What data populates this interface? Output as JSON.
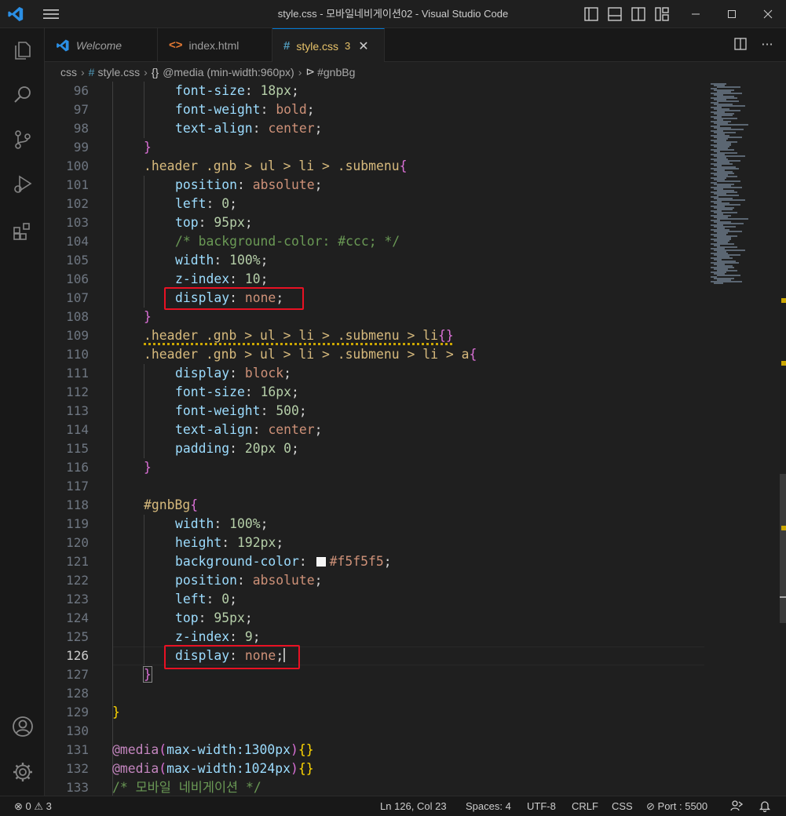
{
  "window": {
    "title": "style.css - 모바일네비게이션02 - Visual Studio Code"
  },
  "tabs": [
    {
      "label": "Welcome",
      "icon": "vscode-icon"
    },
    {
      "label": "index.html",
      "icon": "html-icon"
    },
    {
      "label": "style.css",
      "icon": "css-icon",
      "badge": "3",
      "active": true
    }
  ],
  "breadcrumb": {
    "folder": "css",
    "file": "style.css",
    "media_icon": "{}",
    "media": "@media (min-width:960px)",
    "selector": "#gnbBg"
  },
  "editor": {
    "line_numbers": [
      "96",
      "97",
      "98",
      "99",
      "100",
      "101",
      "102",
      "103",
      "104",
      "105",
      "106",
      "107",
      "108",
      "109",
      "110",
      "111",
      "112",
      "113",
      "114",
      "115",
      "116",
      "117",
      "118",
      "119",
      "120",
      "121",
      "122",
      "123",
      "124",
      "125",
      "126",
      "127",
      "128",
      "129",
      "130",
      "131",
      "132",
      "133"
    ],
    "current_line": "126",
    "lines": {
      "l96": {
        "p": "font-size",
        "v": "18px"
      },
      "l97": {
        "p": "font-weight",
        "v": "bold"
      },
      "l98": {
        "p": "text-align",
        "v": "center"
      },
      "l99": {
        "b": "}"
      },
      "l100": {
        "s": ".header .gnb > ul > li > .submenu",
        "b": "{"
      },
      "l101": {
        "p": "position",
        "v": "absolute"
      },
      "l102": {
        "p": "left",
        "v": "0"
      },
      "l103": {
        "p": "top",
        "v": "95px"
      },
      "l104": {
        "c": "/* background-color: #ccc; */"
      },
      "l105": {
        "p": "width",
        "v": "100%"
      },
      "l106": {
        "p": "z-index",
        "v": "10"
      },
      "l107": {
        "p": "display",
        "v": "none"
      },
      "l108": {
        "b": "}"
      },
      "l109": {
        "s": ".header .gnb > ul > li > .submenu > li",
        "b": "{}"
      },
      "l110": {
        "s": ".header .gnb > ul > li > .submenu > li > a",
        "b": "{"
      },
      "l111": {
        "p": "display",
        "v": "block"
      },
      "l112": {
        "p": "font-size",
        "v": "16px"
      },
      "l113": {
        "p": "font-weight",
        "v": "500"
      },
      "l114": {
        "p": "text-align",
        "v": "center"
      },
      "l115": {
        "p": "padding",
        "v": "20px 0"
      },
      "l116": {
        "b": "}"
      },
      "l118": {
        "s": "#gnbBg",
        "b": "{"
      },
      "l119": {
        "p": "width",
        "v": "100%"
      },
      "l120": {
        "p": "height",
        "v": "192px"
      },
      "l121": {
        "p": "background-color",
        "v": "#f5f5f5"
      },
      "l122": {
        "p": "position",
        "v": "absolute"
      },
      "l123": {
        "p": "left",
        "v": "0"
      },
      "l124": {
        "p": "top",
        "v": "95px"
      },
      "l125": {
        "p": "z-index",
        "v": "9"
      },
      "l126": {
        "p": "display",
        "v": "none"
      },
      "l127": {
        "b": "}"
      },
      "l129": {
        "b": "}"
      },
      "l131": {
        "at": "@media",
        "q": "max-width:1300px",
        "b": "{}"
      },
      "l132": {
        "at": "@media",
        "q": "max-width:1024px",
        "b": "{}"
      },
      "l133": {
        "c": "/* 모바일 네비게이션 */"
      }
    },
    "swatch_color": "#f5f5f5"
  },
  "status": {
    "errors": "0",
    "warnings": "3",
    "position": "Ln 126, Col 23",
    "spaces": "Spaces: 4",
    "encoding": "UTF-8",
    "eol": "CRLF",
    "language": "CSS",
    "port": "Port : 5500"
  },
  "colors": {
    "accent": "#0078d4",
    "highlight_box": "#e81123",
    "warning": "#cca700"
  }
}
